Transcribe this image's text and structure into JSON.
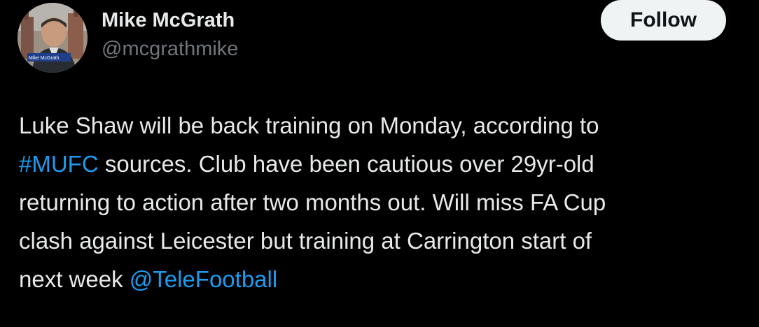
{
  "author": {
    "display_name": "Mike McGrath",
    "handle": "@mcgrathmike",
    "avatar_caption": "Mike McGrath"
  },
  "follow_button": {
    "label": "Follow"
  },
  "tweet": {
    "line1": "Luke Shaw will be back training on Monday, according to",
    "hashtag": "#MUFC",
    "line2_rest": " sources. Club have been cautious over 29yr-old",
    "line3": "returning to action after two months out. Will miss FA Cup",
    "line4": "clash against Leicester but training at Carrington start of",
    "line5_start": "next week ",
    "mention": "@TeleFootball"
  },
  "colors": {
    "background": "#000000",
    "text": "#e7e9ea",
    "secondary_text": "#71767b",
    "link": "#1d9bf0",
    "follow_bg": "#eff3f4",
    "follow_text": "#0f1419"
  }
}
